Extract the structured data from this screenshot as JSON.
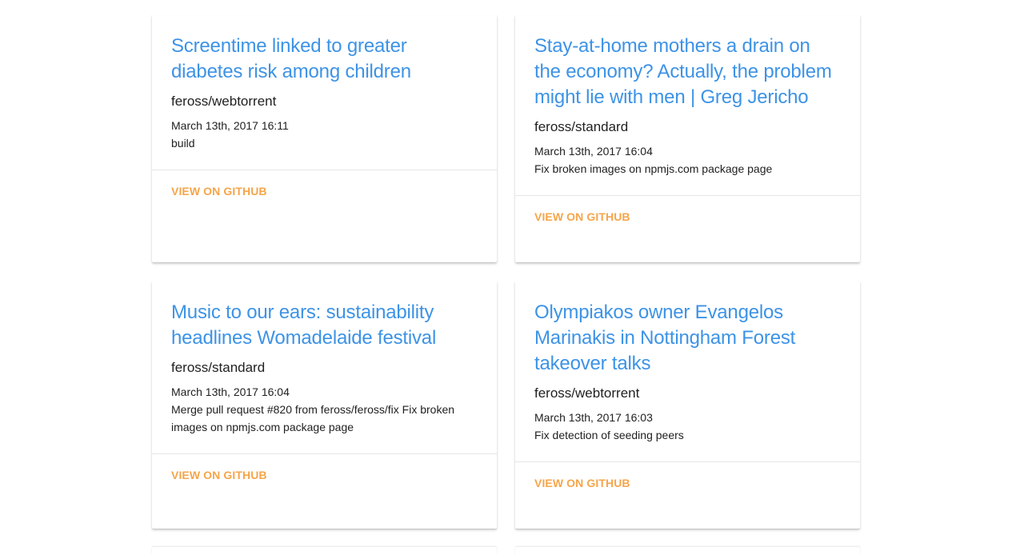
{
  "cards": [
    {
      "title": "Screentime linked to greater diabetes risk among children",
      "repo": "feross/webtorrent",
      "date": "March 13th, 2017 16:11",
      "message": "build",
      "action_label": "VIEW ON GITHUB"
    },
    {
      "title": "Stay-at-home mothers a drain on the economy? Actually, the problem might lie with men | Greg Jericho",
      "repo": "feross/standard",
      "date": "March 13th, 2017 16:04",
      "message": "Fix broken images on npmjs.com package page",
      "action_label": "VIEW ON GITHUB"
    },
    {
      "title": "Music to our ears: sustainability headlines Womadelaide festival",
      "repo": "feross/standard",
      "date": "March 13th, 2017 16:04",
      "message": "Merge pull request #820 from feross/feross/fix Fix broken images on npmjs.com package page",
      "action_label": "VIEW ON GITHUB"
    },
    {
      "title": "Olympiakos owner Evangelos Marinakis in Nottingham Forest takeover talks",
      "repo": "feross/webtorrent",
      "date": "March 13th, 2017 16:03",
      "message": "Fix detection of seeding peers",
      "action_label": "VIEW ON GITHUB"
    }
  ],
  "colors": {
    "title": "#3d93e6",
    "action": "#f6a54a",
    "text": "#212121",
    "divider": "#e6e6e6"
  }
}
